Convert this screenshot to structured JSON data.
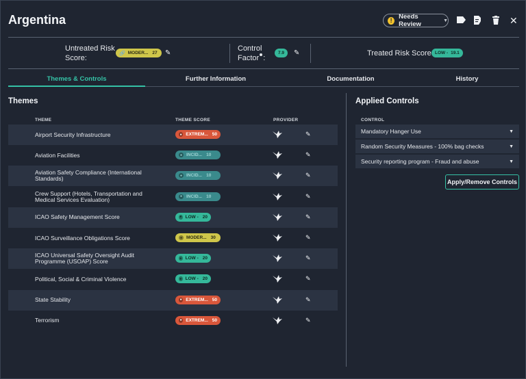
{
  "header": {
    "title": "Argentina",
    "review_label": "Needs Review",
    "icons": [
      "tag-icon",
      "document-edit-icon",
      "trash-icon",
      "close-icon"
    ]
  },
  "risk": {
    "untreated_label_1": "Untreated Risk",
    "untreated_label_2": "Score:",
    "untreated_badge": "MODER...",
    "untreated_value": "27",
    "control_label_1": "Control",
    "control_label_2": "Factor",
    "control_value": "7.9",
    "treated_label": "Treated Risk Score:",
    "treated_badge": "LOW -",
    "treated_value": "19.1"
  },
  "tabs": [
    "Themes & Controls",
    "Further Information",
    "Documentation",
    "History"
  ],
  "themes": {
    "title": "Themes",
    "columns": [
      "THEME",
      "THEME SCORE",
      "PROVIDER"
    ],
    "rows": [
      {
        "name": "Airport Security Infrastructure",
        "badge": "EXTREM...",
        "score": "50",
        "level": "extreme"
      },
      {
        "name": "Aviation Facilities",
        "badge": "INCID...",
        "score": "10",
        "level": "incident"
      },
      {
        "name": "Aviation Safety Compliance (International Standards)",
        "badge": "INCID...",
        "score": "10",
        "level": "incident"
      },
      {
        "name": "Crew Support (Hotels, Transportation and Medical Services Evaluation)",
        "badge": "INCID...",
        "score": "10",
        "level": "incident"
      },
      {
        "name": "ICAO Safety Management Score",
        "badge": "LOW -",
        "score": "20",
        "level": "low"
      },
      {
        "name": "ICAO Surveillance Obligations Score",
        "badge": "MODER...",
        "score": "30",
        "level": "moderate"
      },
      {
        "name": "ICAO Universal Safety Oversight Audit Programme (USOAP) Score",
        "badge": "LOW -",
        "score": "20",
        "level": "low"
      },
      {
        "name": "Political, Social & Criminal Violence",
        "badge": "LOW -",
        "score": "20",
        "level": "low"
      },
      {
        "name": "State Stability",
        "badge": "EXTREM...",
        "score": "50",
        "level": "extreme"
      },
      {
        "name": "Terrorism",
        "badge": "EXTREM...",
        "score": "50",
        "level": "extreme"
      }
    ]
  },
  "controls": {
    "title": "Applied Controls",
    "column": "CONTROL",
    "items": [
      "Mandatory Hanger Use",
      "Random Security Measures - 100% bag checks",
      "Security reporting program - Fraud and abuse"
    ],
    "apply_label": "Apply/Remove Controls"
  },
  "colors": {
    "accent": "#35c2a6",
    "extreme": "#d9573b",
    "moderate": "#cfc64a",
    "low": "#35b89a",
    "incident": "#3a8a8c"
  }
}
